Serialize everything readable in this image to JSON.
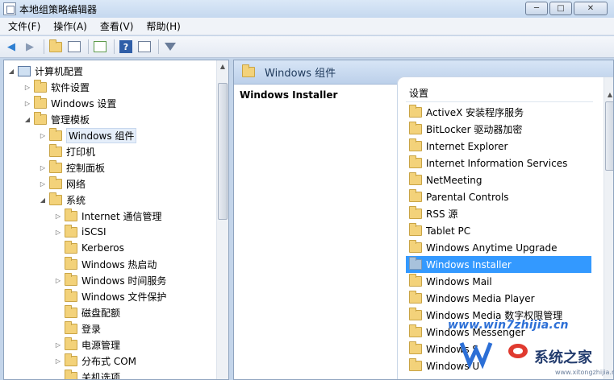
{
  "window": {
    "title": "本地组策略编辑器",
    "buttons": [
      "─",
      "□",
      "✕"
    ]
  },
  "menu": [
    "文件(F)",
    "操作(A)",
    "查看(V)",
    "帮助(H)"
  ],
  "tree": {
    "root": "计算机配置",
    "items": [
      "软件设置",
      "Windows 设置",
      "管理模板",
      "Windows 组件",
      "打印机",
      "控制面板",
      "网络",
      "系统",
      "Internet 通信管理",
      "iSCSI",
      "Kerberos",
      "Windows 热启动",
      "Windows 时间服务",
      "Windows 文件保护",
      "磁盘配额",
      "登录",
      "电源管理",
      "分布式 COM",
      "关机选项"
    ]
  },
  "right": {
    "header": "Windows 组件",
    "policy_title": "Windows Installer",
    "list_header": "设置",
    "items": [
      "ActiveX 安装程序服务",
      "BitLocker 驱动器加密",
      "Internet Explorer",
      "Internet Information Services",
      "NetMeeting",
      "Parental Controls",
      "RSS 源",
      "Tablet PC",
      "Windows Anytime Upgrade",
      "Windows Installer",
      "Windows Mail",
      "Windows Media Player",
      "Windows Media 数字权限管理",
      "Windows Messenger",
      "Windows S",
      "Windows U"
    ],
    "selected_index": 9,
    "selection_color": "#3399ff"
  },
  "watermark": {
    "url": "www.win7zhijia.cn",
    "brand": "系统之家",
    "site": "www.xitongzhijia.net"
  }
}
